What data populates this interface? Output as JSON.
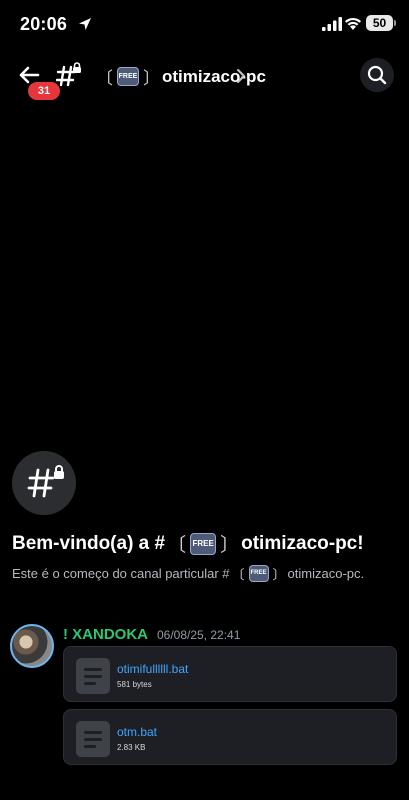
{
  "status_bar": {
    "time": "20:06",
    "battery": "50"
  },
  "header": {
    "unread_count": "31",
    "channel_prefix_open": "〔",
    "free_tag": "FREE",
    "channel_prefix_close": "〕",
    "channel_name": "otimizaco-pc"
  },
  "welcome": {
    "title_before": "Bem-vindo(a) a #",
    "title_open": "〔",
    "title_tag": "FREE",
    "title_close": "〕",
    "title_after": "otimizaco-pc!",
    "subtitle_before": "Este é o começo do canal particular #",
    "subtitle_open": "〔",
    "subtitle_tag": "FREE",
    "subtitle_close": "〕",
    "subtitle_after": "otimizaco-pc."
  },
  "message": {
    "author": "! XANDOKA",
    "author_color": "#2dc770",
    "timestamp": "06/08/25, 22:41",
    "attachments": [
      {
        "name": "otimifullllll.bat",
        "size": "581 bytes"
      },
      {
        "name": "otm.bat",
        "size": "2.83 KB"
      }
    ]
  },
  "icons": [
    "location-arrow-icon",
    "signal-icon",
    "wifi-icon",
    "back-arrow-icon",
    "locked-hash-icon",
    "chevron-right-icon",
    "search-icon",
    "file-icon"
  ]
}
